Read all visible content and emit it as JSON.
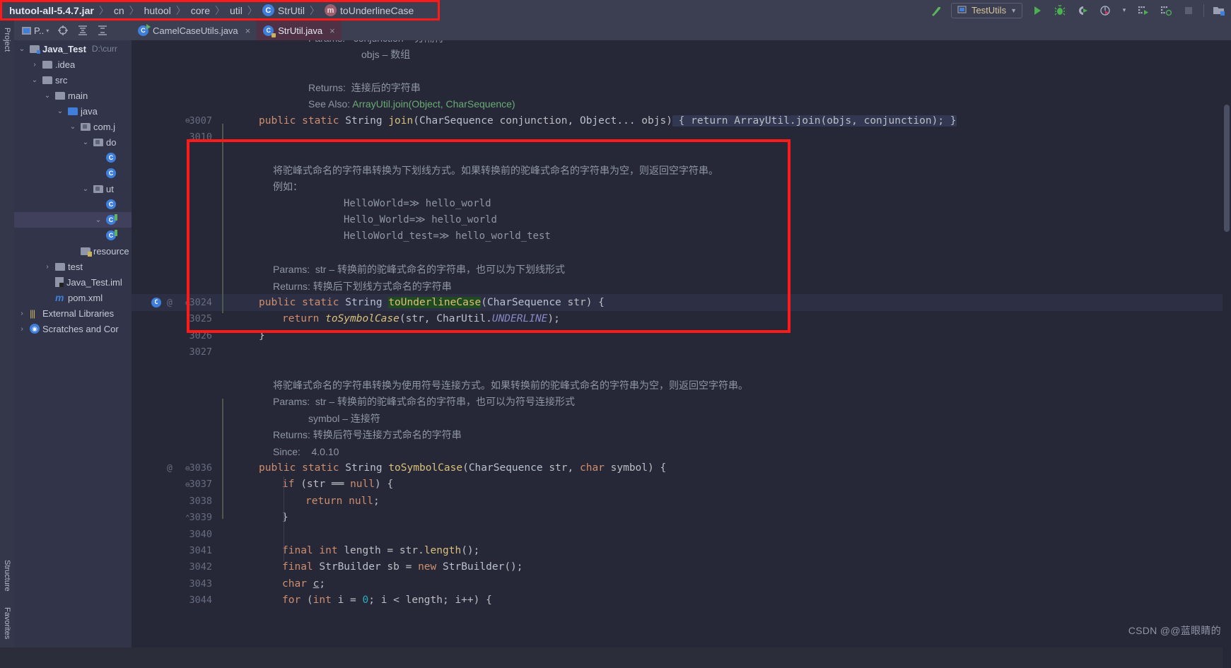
{
  "breadcrumb": {
    "items": [
      {
        "label": "hutool-all-5.4.7.jar",
        "icon": "jar-icon",
        "bold": true
      },
      {
        "label": "cn",
        "icon": "none",
        "bold": false
      },
      {
        "label": "hutool",
        "icon": "none",
        "bold": false
      },
      {
        "label": "core",
        "icon": "none",
        "bold": false
      },
      {
        "label": "util",
        "icon": "none",
        "bold": false
      },
      {
        "label": "StrUtil",
        "icon": "class-icon",
        "bold": false
      },
      {
        "label": "toUnderlineCase",
        "icon": "method-icon",
        "bold": false
      }
    ],
    "separator": "〉",
    "highlight_color": "#ff1a1a"
  },
  "toolbar": {
    "run_config_label": "TestUtils",
    "run_config_caret": "▼",
    "icons": [
      {
        "name": "build-hammer-icon",
        "glyph": "↖"
      },
      {
        "name": "run-icon",
        "glyph": "▶"
      },
      {
        "name": "debug-icon",
        "glyph": "☢"
      },
      {
        "name": "run-coverage-icon",
        "glyph": "◖"
      },
      {
        "name": "profiler-icon",
        "glyph": "◔"
      },
      {
        "name": "profiler-dropdown-icon",
        "glyph": "▾"
      },
      {
        "name": "run-tests-icon",
        "glyph": "☷"
      },
      {
        "name": "run-tests-coverage-icon",
        "glyph": "☷"
      },
      {
        "name": "stop-icon",
        "glyph": "■"
      },
      {
        "name": "open-project-icon",
        "glyph": "❐"
      }
    ]
  },
  "left_strip": {
    "top_tab": "Project",
    "bottom_tabs": [
      "Structure",
      "Favorites"
    ]
  },
  "project_panel": {
    "toolbar": {
      "view_label": "P..",
      "view_caret": "▾",
      "icons": [
        {
          "name": "project-view-icon",
          "glyph": "▣"
        },
        {
          "name": "locate-target-icon",
          "glyph": "⊕"
        },
        {
          "name": "expand-all-icon",
          "glyph": "⨌"
        },
        {
          "name": "collapse-all-icon",
          "glyph": "⨍"
        }
      ]
    },
    "tree": [
      {
        "label": "Java_Test",
        "suffix": "D:\\curr",
        "depth": 0,
        "arrow": "⌄",
        "icon": "project-folder",
        "bold": true,
        "selected": false
      },
      {
        "label": ".idea",
        "suffix": "",
        "depth": 1,
        "arrow": "›",
        "icon": "folder",
        "bold": false,
        "selected": false
      },
      {
        "label": "src",
        "suffix": "",
        "depth": 1,
        "arrow": "⌄",
        "icon": "folder",
        "bold": false,
        "selected": false
      },
      {
        "label": "main",
        "suffix": "",
        "depth": 2,
        "arrow": "⌄",
        "icon": "folder",
        "bold": false,
        "selected": false
      },
      {
        "label": "java",
        "suffix": "",
        "depth": 3,
        "arrow": "⌄",
        "icon": "source-folder",
        "bold": false,
        "selected": false
      },
      {
        "label": "com.j",
        "suffix": "",
        "depth": 4,
        "arrow": "⌄",
        "icon": "package",
        "bold": false,
        "selected": false
      },
      {
        "label": "do",
        "suffix": "",
        "depth": 5,
        "arrow": "⌄",
        "icon": "package",
        "bold": false,
        "selected": false
      },
      {
        "label": "",
        "suffix": "",
        "depth": 6,
        "arrow": "",
        "icon": "class",
        "bold": false,
        "selected": false
      },
      {
        "label": "",
        "suffix": "",
        "depth": 6,
        "arrow": "",
        "icon": "class",
        "bold": false,
        "selected": false
      },
      {
        "label": "ut",
        "suffix": "",
        "depth": 5,
        "arrow": "⌄",
        "icon": "package",
        "bold": false,
        "selected": false
      },
      {
        "label": "",
        "suffix": "",
        "depth": 6,
        "arrow": "",
        "icon": "class",
        "bold": false,
        "selected": false
      },
      {
        "label": "",
        "suffix": "",
        "depth": 6,
        "arrow": "⌄",
        "icon": "class-run",
        "bold": false,
        "selected": true
      },
      {
        "label": "",
        "suffix": "",
        "depth": 6,
        "arrow": "",
        "icon": "class-run",
        "bold": false,
        "selected": false
      },
      {
        "label": "resource",
        "suffix": "",
        "depth": 4,
        "arrow": "",
        "icon": "resource-folder",
        "bold": false,
        "selected": false
      },
      {
        "label": "test",
        "suffix": "",
        "depth": 2,
        "arrow": "›",
        "icon": "folder",
        "bold": false,
        "selected": false
      },
      {
        "label": "Java_Test.iml",
        "suffix": "",
        "depth": 2,
        "arrow": "",
        "icon": "iml",
        "bold": false,
        "selected": false
      },
      {
        "label": "pom.xml",
        "suffix": "",
        "depth": 2,
        "arrow": "",
        "icon": "maven",
        "bold": false,
        "selected": false
      },
      {
        "label": "External Libraries",
        "suffix": "",
        "depth": 0,
        "arrow": "›",
        "icon": "library",
        "bold": false,
        "selected": false
      },
      {
        "label": "Scratches and Cor",
        "suffix": "",
        "depth": 0,
        "arrow": "›",
        "icon": "scratch",
        "bold": false,
        "selected": false
      }
    ]
  },
  "editor": {
    "tabs": [
      {
        "label": "CamelCaseUtils.java",
        "icon": "class-run-icon",
        "active": false,
        "close": "×"
      },
      {
        "label": "StrUtil.java",
        "icon": "class-lock-icon",
        "active": true,
        "close": "×"
      }
    ],
    "lines": [
      {
        "num": "",
        "marker": "",
        "fold": "",
        "kind": "doc",
        "indent": 2,
        "parts": [
          {
            "t": "Params:",
            "c": "plain"
          },
          {
            "t": "   conjunction – 分隔符",
            "c": "plain"
          }
        ]
      },
      {
        "num": "",
        "marker": "",
        "fold": "",
        "kind": "doc",
        "indent": 5,
        "parts": [
          {
            "t": "objs – 数组",
            "c": "plain"
          }
        ]
      },
      {
        "num": "",
        "marker": "",
        "fold": "",
        "kind": "blank",
        "indent": 0,
        "parts": []
      },
      {
        "num": "",
        "marker": "",
        "fold": "",
        "kind": "doc",
        "indent": 2,
        "parts": [
          {
            "t": "Returns:",
            "c": "plain"
          },
          {
            "t": "  连接后的字符串",
            "c": "plain"
          }
        ]
      },
      {
        "num": "",
        "marker": "",
        "fold": "",
        "kind": "doc",
        "indent": 2,
        "parts": [
          {
            "t": "See Also:",
            "c": "plain"
          },
          {
            "t": " ArrayUtil.join(Object, CharSequence)",
            "c": "link"
          }
        ]
      },
      {
        "num": "3007",
        "marker": "",
        "fold": "⊖",
        "kind": "code",
        "indent": 0,
        "parts": [
          {
            "t": "public ",
            "c": "kw"
          },
          {
            "t": "static ",
            "c": "kw"
          },
          {
            "t": "String ",
            "c": "type"
          },
          {
            "t": "join",
            "c": "mth"
          },
          {
            "t": "(",
            "c": "punct"
          },
          {
            "t": "CharSequence",
            "c": "type"
          },
          {
            "t": " conjunction, ",
            "c": "punct"
          },
          {
            "t": "Object",
            "c": "type"
          },
          {
            "t": "... objs)",
            "c": "punct"
          },
          {
            "t": " { return ",
            "c": "fold"
          },
          {
            "t": "ArrayUtil",
            "c": "foldtype"
          },
          {
            "t": ".join(objs, conjunction); }",
            "c": "fold"
          }
        ]
      },
      {
        "num": "3010",
        "marker": "",
        "fold": "",
        "kind": "blank",
        "indent": 0,
        "parts": []
      },
      {
        "num": "",
        "marker": "",
        "fold": "",
        "kind": "blank",
        "indent": 0,
        "parts": []
      },
      {
        "num": "",
        "marker": "",
        "fold": "",
        "kind": "doc",
        "indent": 0,
        "parts": [
          {
            "t": "将驼峰式命名的字符串转换为下划线方式。如果转换前的驼峰式命名的字符串为空，则返回空字符串。",
            "c": "plain"
          }
        ]
      },
      {
        "num": "",
        "marker": "",
        "fold": "",
        "kind": "doc",
        "indent": 0,
        "parts": [
          {
            "t": "例如：",
            "c": "plain"
          }
        ]
      },
      {
        "num": "",
        "marker": "",
        "fold": "",
        "kind": "docmono",
        "indent": 4,
        "parts": [
          {
            "t": "HelloWorld=≫ hello_world",
            "c": "plain"
          }
        ]
      },
      {
        "num": "",
        "marker": "",
        "fold": "",
        "kind": "docmono",
        "indent": 4,
        "parts": [
          {
            "t": "Hello_World=≫ hello_world",
            "c": "plain"
          }
        ]
      },
      {
        "num": "",
        "marker": "",
        "fold": "",
        "kind": "docmono",
        "indent": 4,
        "parts": [
          {
            "t": "HelloWorld_test=≫ hello_world_test",
            "c": "plain"
          }
        ]
      },
      {
        "num": "",
        "marker": "",
        "fold": "",
        "kind": "blank",
        "indent": 0,
        "parts": []
      },
      {
        "num": "",
        "marker": "",
        "fold": "",
        "kind": "doc",
        "indent": 0,
        "parts": [
          {
            "t": "Params:",
            "c": "plain"
          },
          {
            "t": "  str – 转换前的驼峰式命名的字符串，也可以为下划线形式",
            "c": "plain"
          }
        ]
      },
      {
        "num": "",
        "marker": "",
        "fold": "",
        "kind": "doc",
        "indent": 0,
        "parts": [
          {
            "t": "Returns:",
            "c": "plain"
          },
          {
            "t": " 转换后下划线方式命名的字符串",
            "c": "plain"
          }
        ]
      },
      {
        "num": "3024",
        "marker": "@",
        "fold": "⊖",
        "kind": "code",
        "indent": 0,
        "cls_gutter": true,
        "caret": true,
        "parts": [
          {
            "t": "public ",
            "c": "kw"
          },
          {
            "t": "static ",
            "c": "kw"
          },
          {
            "t": "String ",
            "c": "type"
          },
          {
            "t": "toUnderlineCase",
            "c": "hl"
          },
          {
            "t": "(",
            "c": "punct"
          },
          {
            "t": "CharSequence",
            "c": "type"
          },
          {
            "t": " str) {",
            "c": "punct"
          }
        ]
      },
      {
        "num": "3025",
        "marker": "",
        "fold": "",
        "kind": "code",
        "indent": 1,
        "parts": [
          {
            "t": "return ",
            "c": "kw"
          },
          {
            "t": "toSymbolCase",
            "c": "mthital"
          },
          {
            "t": "(str, ",
            "c": "punct"
          },
          {
            "t": "CharUtil",
            "c": "type"
          },
          {
            "t": ".",
            "c": "punct"
          },
          {
            "t": "UNDERLINE",
            "c": "staticf"
          },
          {
            "t": ");",
            "c": "punct"
          }
        ]
      },
      {
        "num": "3026",
        "marker": "",
        "fold": "",
        "kind": "code",
        "indent": 0,
        "parts": [
          {
            "t": "}",
            "c": "punct"
          }
        ]
      },
      {
        "num": "3027",
        "marker": "",
        "fold": "",
        "kind": "blank",
        "indent": 0,
        "parts": []
      },
      {
        "num": "",
        "marker": "",
        "fold": "",
        "kind": "blank",
        "indent": 0,
        "parts": []
      },
      {
        "num": "",
        "marker": "",
        "fold": "",
        "kind": "doc",
        "indent": 0,
        "parts": [
          {
            "t": "将驼峰式命名的字符串转换为使用符号连接方式。如果转换前的驼峰式命名的字符串为空，则返回空字符串。",
            "c": "plain"
          }
        ]
      },
      {
        "num": "",
        "marker": "",
        "fold": "",
        "kind": "doc",
        "indent": 0,
        "parts": [
          {
            "t": "Params:",
            "c": "plain"
          },
          {
            "t": "  str – 转换前的驼峰式命名的字符串，也可以为符号连接形式",
            "c": "plain"
          }
        ]
      },
      {
        "num": "",
        "marker": "",
        "fold": "",
        "kind": "doc",
        "indent": 2,
        "parts": [
          {
            "t": "symbol – 连接符",
            "c": "plain"
          }
        ]
      },
      {
        "num": "",
        "marker": "",
        "fold": "",
        "kind": "doc",
        "indent": 0,
        "parts": [
          {
            "t": "Returns:",
            "c": "plain"
          },
          {
            "t": " 转换后符号连接方式命名的字符串",
            "c": "plain"
          }
        ]
      },
      {
        "num": "",
        "marker": "",
        "fold": "",
        "kind": "doc",
        "indent": 0,
        "parts": [
          {
            "t": "Since:",
            "c": "plain"
          },
          {
            "t": "    4.0.10",
            "c": "plain"
          }
        ]
      },
      {
        "num": "3036",
        "marker": "@",
        "fold": "⊖",
        "kind": "code",
        "indent": 0,
        "parts": [
          {
            "t": "public ",
            "c": "kw"
          },
          {
            "t": "static ",
            "c": "kw"
          },
          {
            "t": "String ",
            "c": "type"
          },
          {
            "t": "toSymbolCase",
            "c": "mth"
          },
          {
            "t": "(",
            "c": "punct"
          },
          {
            "t": "CharSequence",
            "c": "type"
          },
          {
            "t": " str, ",
            "c": "punct"
          },
          {
            "t": "char",
            "c": "kw"
          },
          {
            "t": " symbol) {",
            "c": "punct"
          }
        ]
      },
      {
        "num": "3037",
        "marker": "",
        "fold": "⊖",
        "kind": "code",
        "indent": 1,
        "parts": [
          {
            "t": "if ",
            "c": "kw"
          },
          {
            "t": "(str ",
            "c": "punct"
          },
          {
            "t": "══",
            "c": "punct"
          },
          {
            "t": " ",
            "c": "punct"
          },
          {
            "t": "null",
            "c": "kw"
          },
          {
            "t": ") {",
            "c": "punct"
          }
        ]
      },
      {
        "num": "3038",
        "marker": "",
        "fold": "",
        "kind": "code",
        "indent": 2,
        "parts": [
          {
            "t": "return ",
            "c": "kw"
          },
          {
            "t": "null",
            "c": "kw"
          },
          {
            "t": ";",
            "c": "punct"
          }
        ]
      },
      {
        "num": "3039",
        "marker": "",
        "fold": "⌃",
        "kind": "code",
        "indent": 1,
        "parts": [
          {
            "t": "}",
            "c": "punct"
          }
        ]
      },
      {
        "num": "3040",
        "marker": "",
        "fold": "",
        "kind": "blank",
        "indent": 0,
        "parts": []
      },
      {
        "num": "3041",
        "marker": "",
        "fold": "",
        "kind": "code",
        "indent": 1,
        "parts": [
          {
            "t": "final ",
            "c": "kw"
          },
          {
            "t": "int ",
            "c": "kw"
          },
          {
            "t": "length ",
            "c": "punct"
          },
          {
            "t": "= str.",
            "c": "punct"
          },
          {
            "t": "length",
            "c": "mth2"
          },
          {
            "t": "();",
            "c": "punct"
          }
        ]
      },
      {
        "num": "3042",
        "marker": "",
        "fold": "",
        "kind": "code",
        "indent": 1,
        "parts": [
          {
            "t": "final ",
            "c": "kw"
          },
          {
            "t": "StrBuilder ",
            "c": "type"
          },
          {
            "t": "sb = ",
            "c": "punct"
          },
          {
            "t": "new ",
            "c": "kw"
          },
          {
            "t": "StrBuilder",
            "c": "type"
          },
          {
            "t": "();",
            "c": "punct"
          }
        ]
      },
      {
        "num": "3043",
        "marker": "",
        "fold": "",
        "kind": "code",
        "indent": 1,
        "parts": [
          {
            "t": "char ",
            "c": "kw"
          },
          {
            "t": "c",
            "c": "underline"
          },
          {
            "t": ";",
            "c": "punct"
          }
        ]
      },
      {
        "num": "3044",
        "marker": "",
        "fold": "",
        "kind": "code",
        "indent": 1,
        "parts": [
          {
            "t": "for ",
            "c": "kw"
          },
          {
            "t": "(",
            "c": "punct"
          },
          {
            "t": "int ",
            "c": "kw"
          },
          {
            "t": "i = ",
            "c": "punct"
          },
          {
            "t": "0",
            "c": "num"
          },
          {
            "t": "; i < length; i++) {",
            "c": "punct"
          }
        ]
      }
    ]
  },
  "watermark": "CSDN @@蓝眼睛的"
}
